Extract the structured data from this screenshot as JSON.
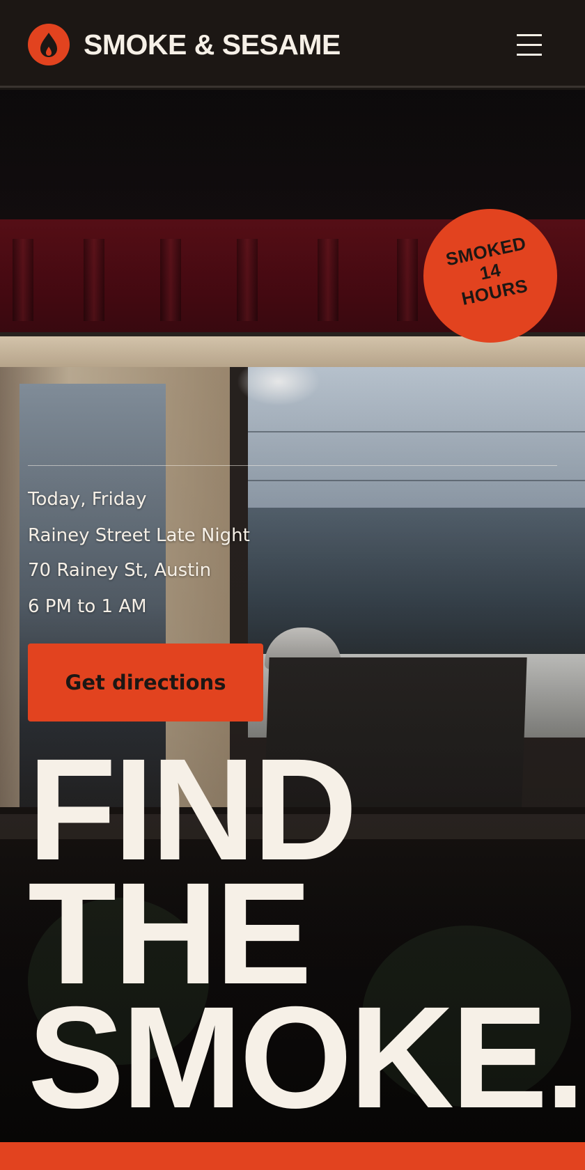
{
  "header": {
    "brand": "SMOKE & SESAME",
    "logo_icon": "flame-icon",
    "menu_icon": "hamburger-menu-icon"
  },
  "badge": {
    "line1": "SMOKED",
    "line2": "14",
    "line3": "HOURS"
  },
  "schedule": {
    "day": "Today, Friday",
    "venue": "Rainey Street Late Night",
    "address": "70 Rainey St, Austin",
    "hours": "6 PM to 1 AM"
  },
  "cta": {
    "label": "Get directions"
  },
  "headline": {
    "line1": "FIND",
    "line2": "THE",
    "line3": "SMOKE."
  },
  "colors": {
    "accent": "#e2431f",
    "background": "#1c1714",
    "text_light": "#f6f0e7"
  }
}
